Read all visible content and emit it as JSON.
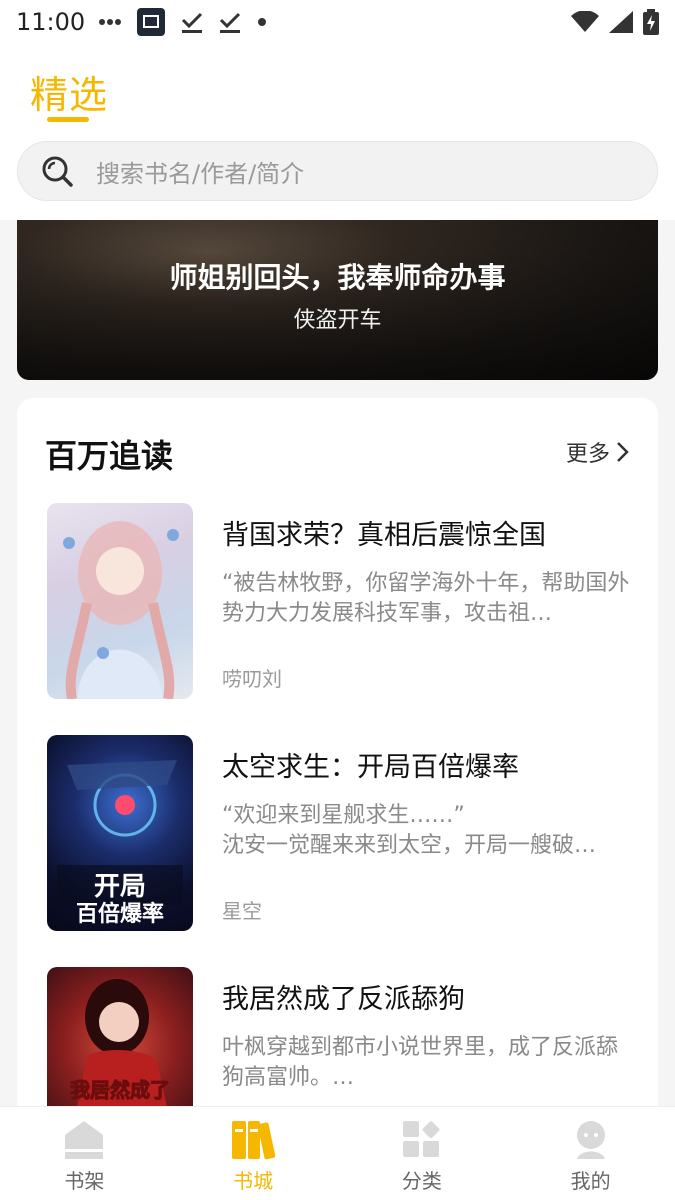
{
  "status_bar": {
    "time": "11:00",
    "icons": [
      "more-dots-icon",
      "app-notification-icon",
      "download-done-icon",
      "download-done-icon",
      "dot-icon",
      "wifi-icon",
      "signal-icon",
      "battery-charging-icon"
    ]
  },
  "header": {
    "tab_title": "精选",
    "search_placeholder": "搜索书名/作者/简介"
  },
  "banner": {
    "title": "师姐别回头，我奉师命办事",
    "author": "侠盗开车"
  },
  "section": {
    "title": "百万追读",
    "more_label": "更多",
    "books": [
      {
        "title": "背国求荣？真相后震惊全国",
        "description": "“被告林牧野，你留学海外十年，帮助国外势力大力发展科技军事，攻击祖…",
        "author": "唠叨刘"
      },
      {
        "title": "太空求生：开局百倍爆率",
        "description": "“欢迎来到星舰求生……”\n沈安一觉醒来来到太空，开局一艘破…",
        "author": "星空"
      },
      {
        "title": "我居然成了反派舔狗",
        "description": "叶枫穿越到都市小说世界里，成了反派舔狗高富帅。…",
        "author": ""
      }
    ]
  },
  "bottom_nav": {
    "items": [
      {
        "label": "书架",
        "icon": "bookshelf-icon",
        "active": false
      },
      {
        "label": "书城",
        "icon": "bookstore-icon",
        "active": true
      },
      {
        "label": "分类",
        "icon": "category-icon",
        "active": false
      },
      {
        "label": "我的",
        "icon": "profile-icon",
        "active": false
      }
    ]
  },
  "colors": {
    "accent": "#f5b700",
    "inactive_icon": "#d9d9d9"
  }
}
